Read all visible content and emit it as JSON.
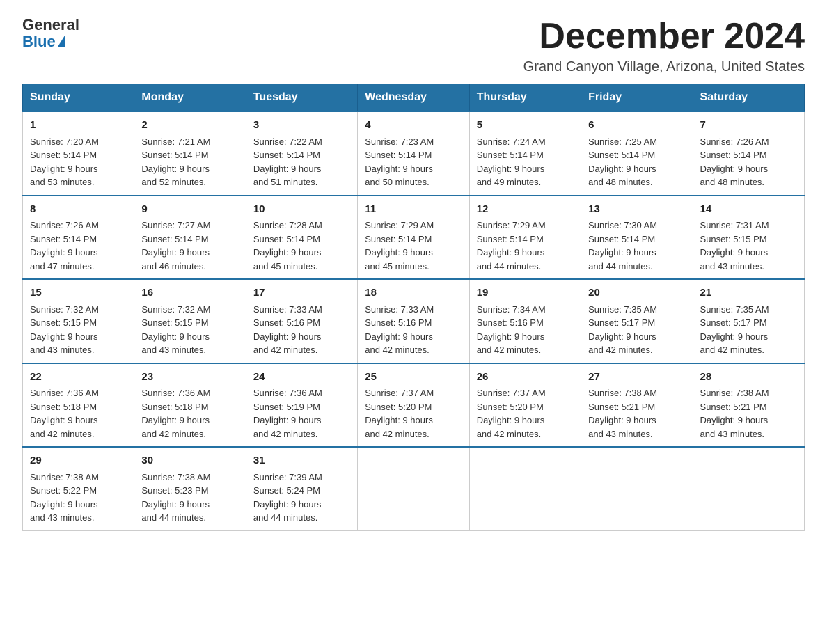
{
  "header": {
    "logo_general": "General",
    "logo_blue": "Blue",
    "month_title": "December 2024",
    "location": "Grand Canyon Village, Arizona, United States"
  },
  "weekdays": [
    "Sunday",
    "Monday",
    "Tuesday",
    "Wednesday",
    "Thursday",
    "Friday",
    "Saturday"
  ],
  "weeks": [
    [
      {
        "day": "1",
        "sunrise": "7:20 AM",
        "sunset": "5:14 PM",
        "daylight": "9 hours and 53 minutes."
      },
      {
        "day": "2",
        "sunrise": "7:21 AM",
        "sunset": "5:14 PM",
        "daylight": "9 hours and 52 minutes."
      },
      {
        "day": "3",
        "sunrise": "7:22 AM",
        "sunset": "5:14 PM",
        "daylight": "9 hours and 51 minutes."
      },
      {
        "day": "4",
        "sunrise": "7:23 AM",
        "sunset": "5:14 PM",
        "daylight": "9 hours and 50 minutes."
      },
      {
        "day": "5",
        "sunrise": "7:24 AM",
        "sunset": "5:14 PM",
        "daylight": "9 hours and 49 minutes."
      },
      {
        "day": "6",
        "sunrise": "7:25 AM",
        "sunset": "5:14 PM",
        "daylight": "9 hours and 48 minutes."
      },
      {
        "day": "7",
        "sunrise": "7:26 AM",
        "sunset": "5:14 PM",
        "daylight": "9 hours and 48 minutes."
      }
    ],
    [
      {
        "day": "8",
        "sunrise": "7:26 AM",
        "sunset": "5:14 PM",
        "daylight": "9 hours and 47 minutes."
      },
      {
        "day": "9",
        "sunrise": "7:27 AM",
        "sunset": "5:14 PM",
        "daylight": "9 hours and 46 minutes."
      },
      {
        "day": "10",
        "sunrise": "7:28 AM",
        "sunset": "5:14 PM",
        "daylight": "9 hours and 45 minutes."
      },
      {
        "day": "11",
        "sunrise": "7:29 AM",
        "sunset": "5:14 PM",
        "daylight": "9 hours and 45 minutes."
      },
      {
        "day": "12",
        "sunrise": "7:29 AM",
        "sunset": "5:14 PM",
        "daylight": "9 hours and 44 minutes."
      },
      {
        "day": "13",
        "sunrise": "7:30 AM",
        "sunset": "5:14 PM",
        "daylight": "9 hours and 44 minutes."
      },
      {
        "day": "14",
        "sunrise": "7:31 AM",
        "sunset": "5:15 PM",
        "daylight": "9 hours and 43 minutes."
      }
    ],
    [
      {
        "day": "15",
        "sunrise": "7:32 AM",
        "sunset": "5:15 PM",
        "daylight": "9 hours and 43 minutes."
      },
      {
        "day": "16",
        "sunrise": "7:32 AM",
        "sunset": "5:15 PM",
        "daylight": "9 hours and 43 minutes."
      },
      {
        "day": "17",
        "sunrise": "7:33 AM",
        "sunset": "5:16 PM",
        "daylight": "9 hours and 42 minutes."
      },
      {
        "day": "18",
        "sunrise": "7:33 AM",
        "sunset": "5:16 PM",
        "daylight": "9 hours and 42 minutes."
      },
      {
        "day": "19",
        "sunrise": "7:34 AM",
        "sunset": "5:16 PM",
        "daylight": "9 hours and 42 minutes."
      },
      {
        "day": "20",
        "sunrise": "7:35 AM",
        "sunset": "5:17 PM",
        "daylight": "9 hours and 42 minutes."
      },
      {
        "day": "21",
        "sunrise": "7:35 AM",
        "sunset": "5:17 PM",
        "daylight": "9 hours and 42 minutes."
      }
    ],
    [
      {
        "day": "22",
        "sunrise": "7:36 AM",
        "sunset": "5:18 PM",
        "daylight": "9 hours and 42 minutes."
      },
      {
        "day": "23",
        "sunrise": "7:36 AM",
        "sunset": "5:18 PM",
        "daylight": "9 hours and 42 minutes."
      },
      {
        "day": "24",
        "sunrise": "7:36 AM",
        "sunset": "5:19 PM",
        "daylight": "9 hours and 42 minutes."
      },
      {
        "day": "25",
        "sunrise": "7:37 AM",
        "sunset": "5:20 PM",
        "daylight": "9 hours and 42 minutes."
      },
      {
        "day": "26",
        "sunrise": "7:37 AM",
        "sunset": "5:20 PM",
        "daylight": "9 hours and 42 minutes."
      },
      {
        "day": "27",
        "sunrise": "7:38 AM",
        "sunset": "5:21 PM",
        "daylight": "9 hours and 43 minutes."
      },
      {
        "day": "28",
        "sunrise": "7:38 AM",
        "sunset": "5:21 PM",
        "daylight": "9 hours and 43 minutes."
      }
    ],
    [
      {
        "day": "29",
        "sunrise": "7:38 AM",
        "sunset": "5:22 PM",
        "daylight": "9 hours and 43 minutes."
      },
      {
        "day": "30",
        "sunrise": "7:38 AM",
        "sunset": "5:23 PM",
        "daylight": "9 hours and 44 minutes."
      },
      {
        "day": "31",
        "sunrise": "7:39 AM",
        "sunset": "5:24 PM",
        "daylight": "9 hours and 44 minutes."
      },
      null,
      null,
      null,
      null
    ]
  ],
  "labels": {
    "sunrise": "Sunrise:",
    "sunset": "Sunset:",
    "daylight": "Daylight:"
  }
}
